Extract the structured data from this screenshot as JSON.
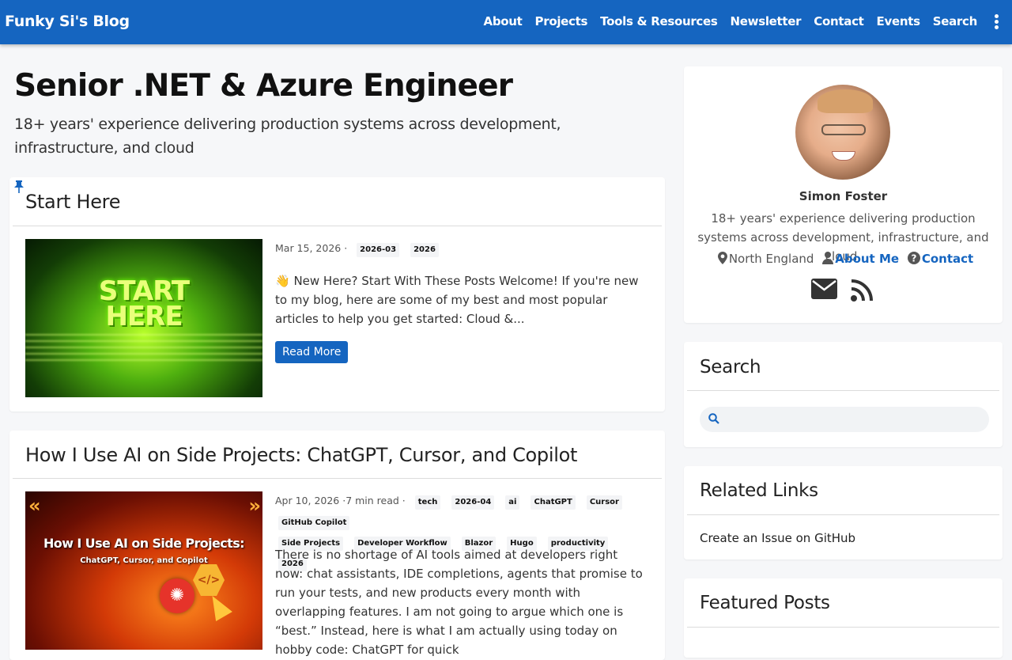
{
  "nav": {
    "brand": "Funky Si's Blog",
    "links": [
      "About",
      "Projects",
      "Tools & Resources",
      "Newsletter",
      "Contact",
      "Events",
      "Search"
    ]
  },
  "hero": {
    "title": "Senior .NET & Azure Engineer",
    "subtitle": "18+ years' experience delivering production systems across development, infrastructure, and cloud"
  },
  "posts": [
    {
      "title": "Start Here",
      "pinned": true,
      "thumb_text": "START HERE",
      "date": "Mar 15, 2026 ·",
      "tags": [
        "2026-03",
        "2026"
      ],
      "excerpt": "👋 New Here? Start With These Posts Welcome! If you're new to my blog, here are some of my best and most popular articles to help you get started: Cloud &...",
      "read_more": "Read More"
    },
    {
      "title": "How I Use AI on Side Projects: ChatGPT, Cursor, and Copilot",
      "thumb_text": "How I Use AI on Side Projects:",
      "thumb_subtext": "ChatGPT, Cursor, and Copilot",
      "date": "Apr 10, 2026 ·7 min read ·",
      "tags": [
        "tech",
        "2026-04",
        "ai",
        "ChatGPT",
        "Cursor",
        "GitHub Copilot",
        "Side Projects",
        "Developer Workflow",
        "Blazor",
        "Hugo",
        "productivity",
        "2026"
      ],
      "excerpt": "There is no shortage of AI tools aimed at developers right now: chat assistants, IDE completions, agents that promise to run your tests, and new products every month with overlapping features. I am not going to argue which one is “best.” Instead, here is what I am actually using today on hobby code: ChatGPT for quick"
    }
  ],
  "profile": {
    "name": "Simon Foster",
    "bio": "18+ years' experience delivering production systems across development, infrastructure, and cloud.",
    "location": "North England",
    "about_link": "About Me",
    "contact_link": "Contact"
  },
  "search_widget": {
    "title": "Search",
    "placeholder": ""
  },
  "related": {
    "title": "Related Links",
    "links": [
      "Create an Issue on GitHub"
    ]
  },
  "featured": {
    "title": "Featured Posts"
  },
  "colors": {
    "primary": "#1565c0",
    "background": "#f6f7f9"
  }
}
